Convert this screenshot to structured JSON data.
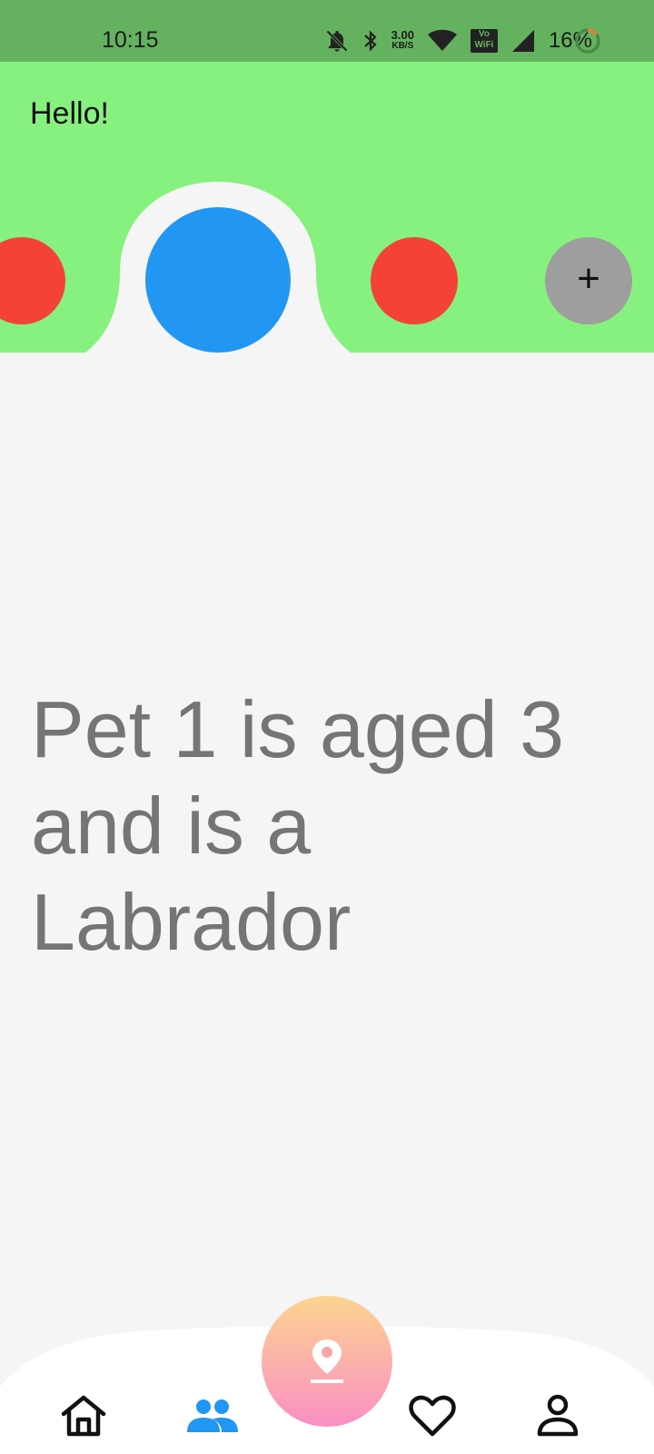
{
  "status_bar": {
    "time": "10:15",
    "net_speed_value": "3.00",
    "net_speed_unit": "KB/S",
    "wifi_badge_top": "Vo",
    "wifi_badge_bottom": "WiFi",
    "battery": "16%"
  },
  "header": {
    "greeting": "Hello!",
    "add_label": "+"
  },
  "main": {
    "pet_description": "Pet 1 is aged 3 and is a Labrador"
  },
  "colors": {
    "status_bar": "#64b25f",
    "header": "#86f17e",
    "selected_pet": "#2196f3",
    "pet": "#f44336",
    "add_button": "#9e9e9e",
    "nav_active": "#2196f3",
    "fab_gradient_top": "#fcd48f",
    "fab_gradient_bottom": "#f98fc4"
  },
  "bottom_nav": {
    "items": [
      {
        "icon": "home-icon",
        "active": false
      },
      {
        "icon": "people-icon",
        "active": true
      },
      {
        "icon": "location-pin-icon",
        "active": false
      },
      {
        "icon": "heart-icon",
        "active": false
      },
      {
        "icon": "person-icon",
        "active": false
      }
    ]
  }
}
